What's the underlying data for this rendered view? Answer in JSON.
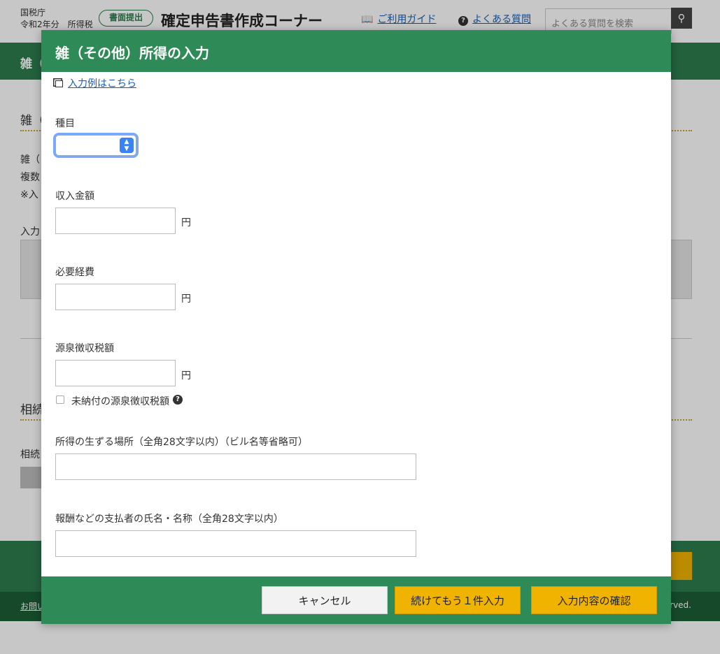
{
  "header": {
    "agency": "国税庁",
    "year_tax": "令和2年分　所得税",
    "badge": "書面提出",
    "site_title": "確定申告書作成コーナー",
    "guide_link": "ご利用ガイド",
    "faq_link": "よくある質問",
    "search_placeholder": "よくある質問を検索",
    "search_icon": "magnifier-icon"
  },
  "background": {
    "green_bar_text": "雑（",
    "section1_head": "雑（",
    "text_1": "雑（",
    "text_2": "複数",
    "text_3": "※入",
    "text_4": "入力",
    "section2_head": "相続",
    "text_5": "相続",
    "footer_left": "お問い",
    "footer_right": "rved."
  },
  "modal": {
    "title": "雑（その他）所得の入力",
    "example_link": "入力例はこちら",
    "fields": {
      "category_label": "種目",
      "category_value": "",
      "income_label": "収入金額",
      "income_value": "",
      "income_unit": "円",
      "expense_label": "必要経費",
      "expense_value": "",
      "expense_unit": "円",
      "withholding_label": "源泉徴収税額",
      "withholding_value": "",
      "withholding_unit": "円",
      "unpaid_checkbox_label": "未納付の源泉徴収税額",
      "unpaid_checked": false,
      "place_label": "所得の生ずる場所（全角28文字以内）（ビル名等省略可）",
      "place_value": "",
      "payer_label": "報酬などの支払者の氏名・名称（全角28文字以内）",
      "payer_value": ""
    },
    "buttons": {
      "cancel": "キャンセル",
      "add_another": "続けてもう１件入力",
      "confirm": "入力内容の確認"
    }
  },
  "colors": {
    "primary_green": "#2e8b57",
    "dark_green": "#1b5e36",
    "accent_gold": "#f0b400",
    "link_blue": "#1a5fb4"
  }
}
